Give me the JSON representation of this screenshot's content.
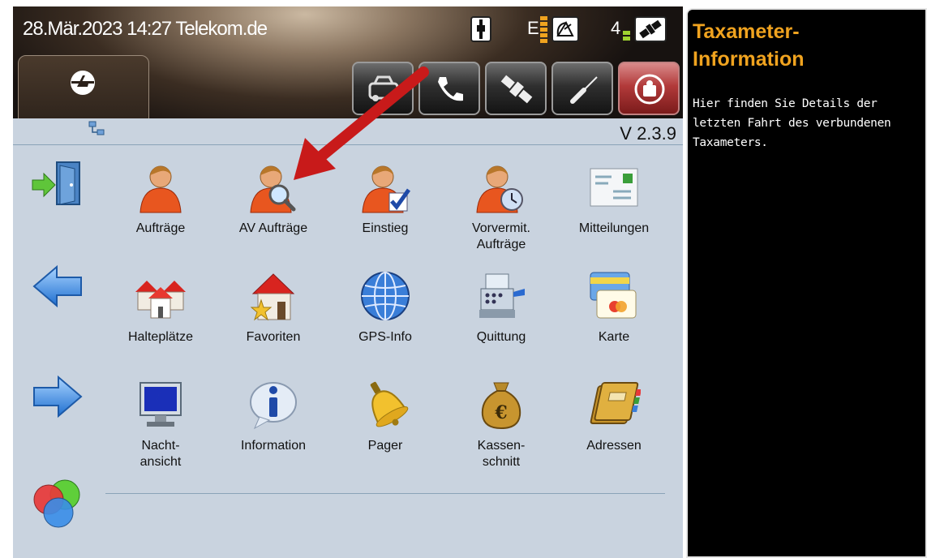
{
  "status_bar": {
    "datetime": "28.Mär.2023 14:27",
    "carrier": "Telekom.de",
    "network_letter": "E",
    "satellite_count": "4"
  },
  "toolbar": {
    "buttons": [
      {
        "icon": "taxi-icon"
      },
      {
        "icon": "phone-icon"
      },
      {
        "icon": "satellite-icon"
      },
      {
        "icon": "screwdriver-icon"
      },
      {
        "icon": "sos-icon"
      }
    ]
  },
  "main": {
    "version": "V 2.3.9",
    "side": [
      {
        "icon": "exit-door-icon"
      },
      {
        "icon": "arrow-left-icon"
      },
      {
        "icon": "arrow-right-icon"
      },
      {
        "icon": "color-circles-icon"
      }
    ],
    "grid": [
      {
        "label": "Aufträge",
        "icon": "person-icon"
      },
      {
        "label": "AV Aufträge",
        "icon": "person-search-icon"
      },
      {
        "label": "Einstieg",
        "icon": "person-check-icon"
      },
      {
        "label": "Vorvermit.\nAufträge",
        "icon": "person-clock-icon"
      },
      {
        "label": "Mitteilungen",
        "icon": "message-icon"
      },
      {
        "label": "Halteplätze",
        "icon": "houses-icon"
      },
      {
        "label": "Favoriten",
        "icon": "house-star-icon"
      },
      {
        "label": "GPS-Info",
        "icon": "globe-icon"
      },
      {
        "label": "Quittung",
        "icon": "cash-register-icon"
      },
      {
        "label": "Karte",
        "icon": "card-icon"
      },
      {
        "label": "Nacht-\nansicht",
        "icon": "night-monitor-icon"
      },
      {
        "label": "Information",
        "icon": "info-bubble-icon"
      },
      {
        "label": "Pager",
        "icon": "bell-icon"
      },
      {
        "label": "Kassen-\nschnitt",
        "icon": "money-bag-icon"
      },
      {
        "label": "Adressen",
        "icon": "address-book-icon"
      }
    ]
  },
  "info_panel": {
    "title": "Taxameter-\nInformation",
    "body": "Hier finden Sie Details der letzten Fahrt des verbundenen Taxameters."
  },
  "colors": {
    "panel_bg": "#c9d3df",
    "info_title": "#f0a31f",
    "arrow": "#c81a1a"
  }
}
